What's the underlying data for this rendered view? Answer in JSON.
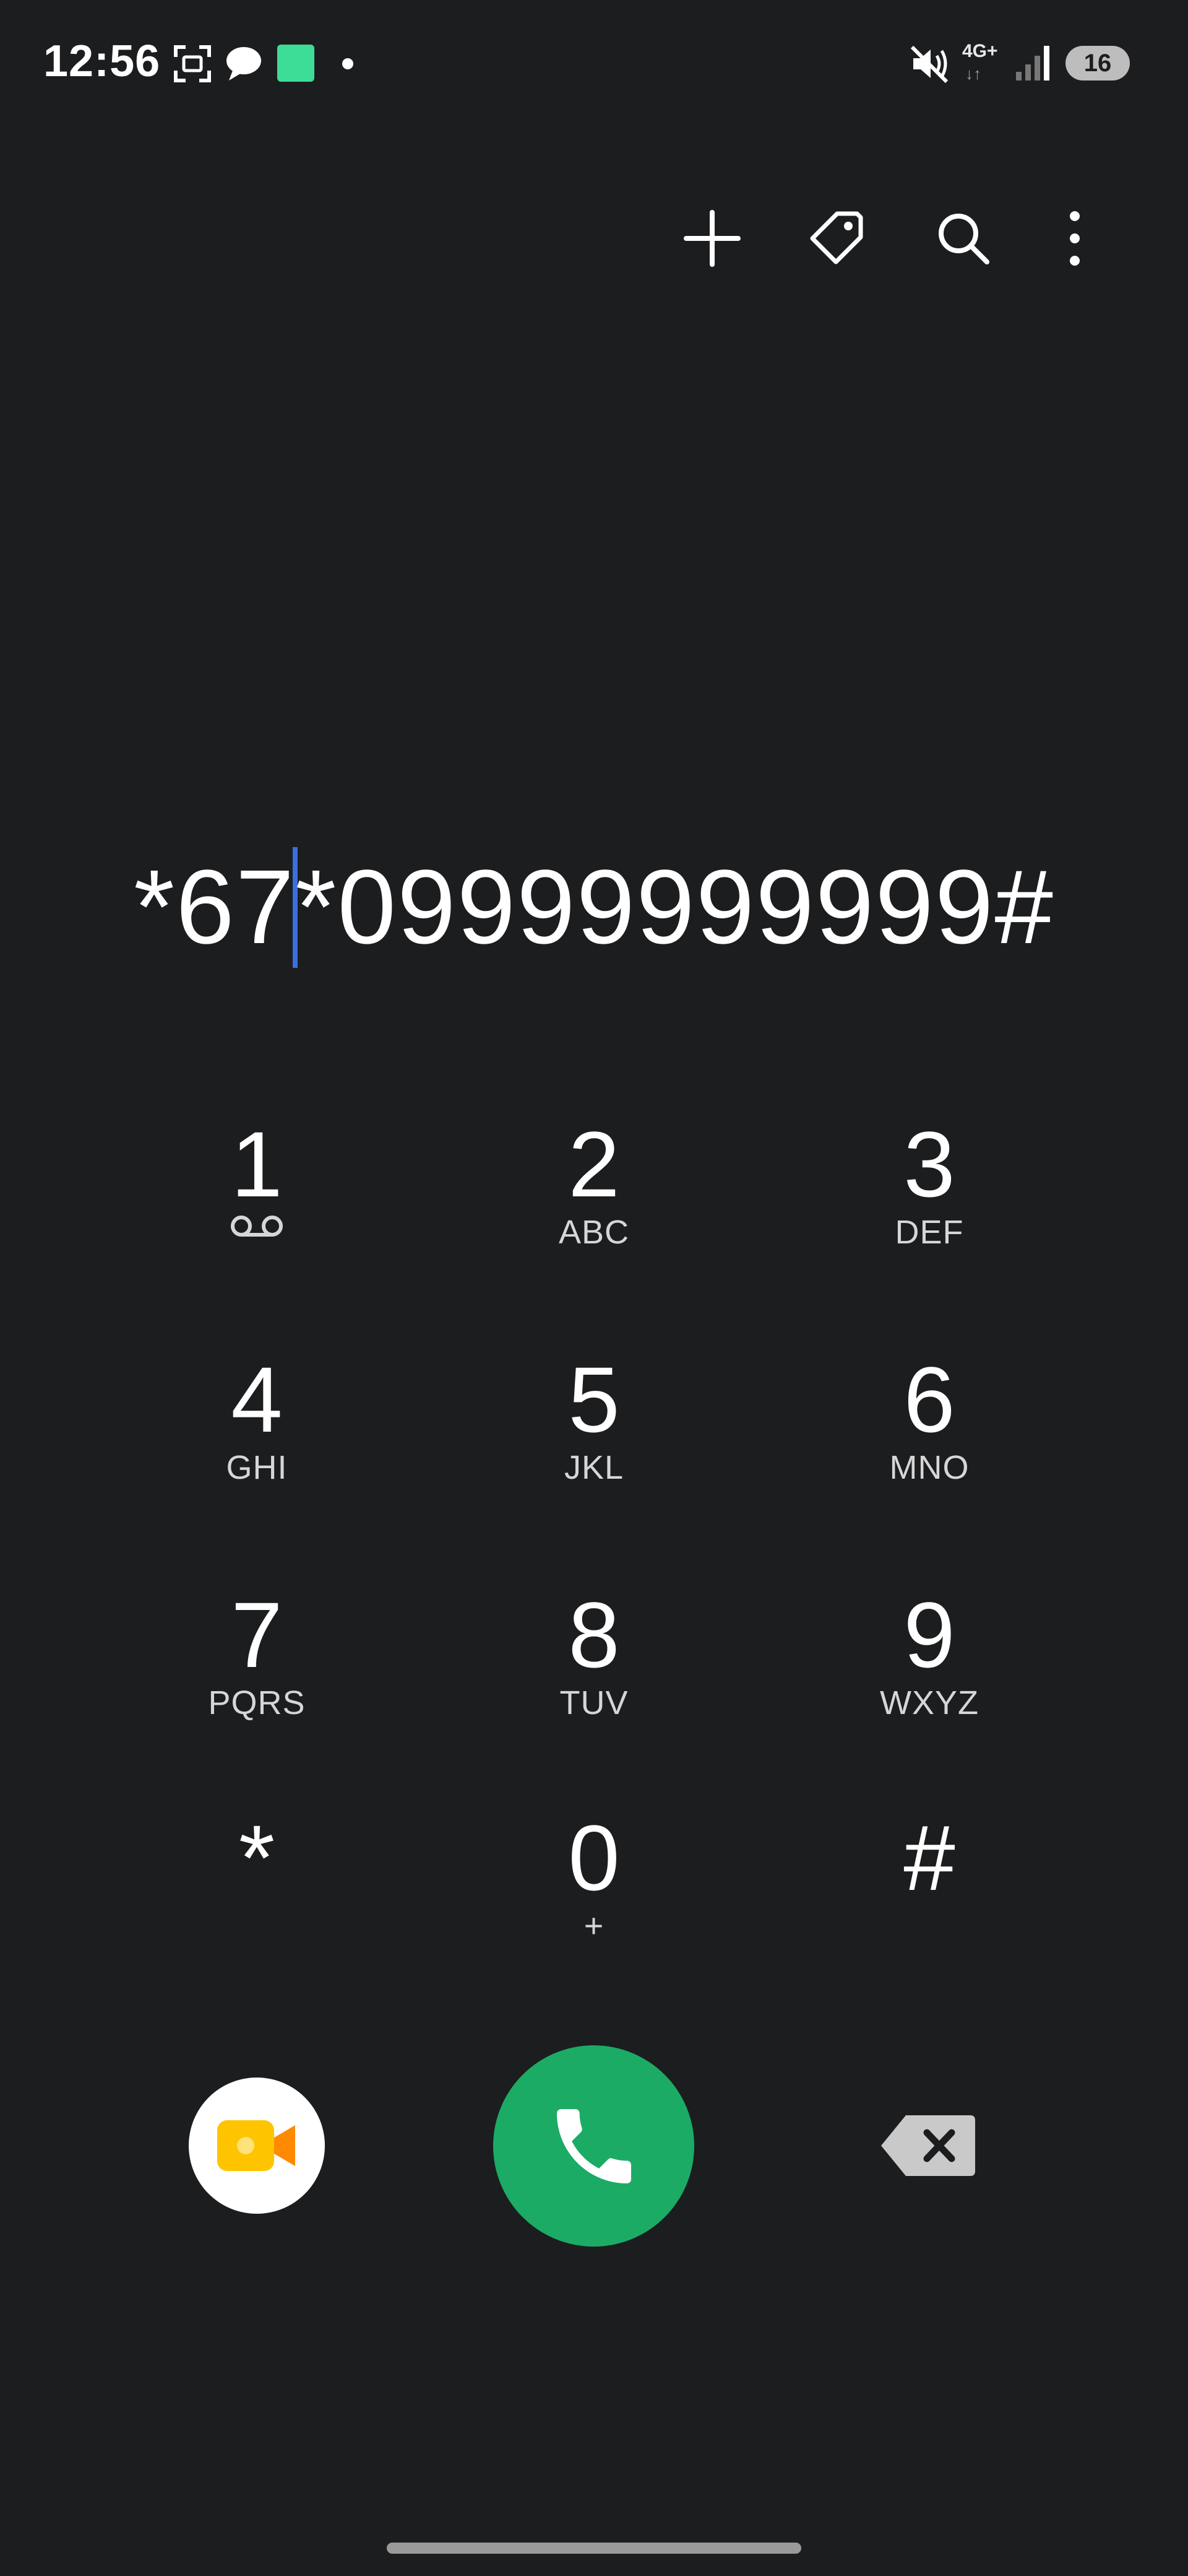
{
  "status_bar": {
    "time": "12:56",
    "network": "4G+",
    "network_arrows": "↓↑",
    "battery": "16"
  },
  "actions": {
    "add_icon": "plus-icon",
    "tag_icon": "tag-icon",
    "search_icon": "search-icon",
    "more_icon": "more-vertical-icon"
  },
  "dialer": {
    "before_cursor": "*67",
    "after_cursor": "*09999999999#"
  },
  "keypad": {
    "k1": {
      "digit": "1",
      "letters": ""
    },
    "k2": {
      "digit": "2",
      "letters": "ABC"
    },
    "k3": {
      "digit": "3",
      "letters": "DEF"
    },
    "k4": {
      "digit": "4",
      "letters": "GHI"
    },
    "k5": {
      "digit": "5",
      "letters": "JKL"
    },
    "k6": {
      "digit": "6",
      "letters": "MNO"
    },
    "k7": {
      "digit": "7",
      "letters": "PQRS"
    },
    "k8": {
      "digit": "8",
      "letters": "TUV"
    },
    "k9": {
      "digit": "9",
      "letters": "WXYZ"
    },
    "kstar": {
      "digit": "*",
      "letters": ""
    },
    "k0": {
      "digit": "0",
      "letters": "+"
    },
    "khash": {
      "digit": "#",
      "letters": ""
    }
  },
  "colors": {
    "background": "#1c1d1f",
    "call_green": "#1bab65",
    "cursor_blue": "#3b6fe0",
    "video_yellow": "#ffc400",
    "video_orange": "#ff8a00"
  }
}
